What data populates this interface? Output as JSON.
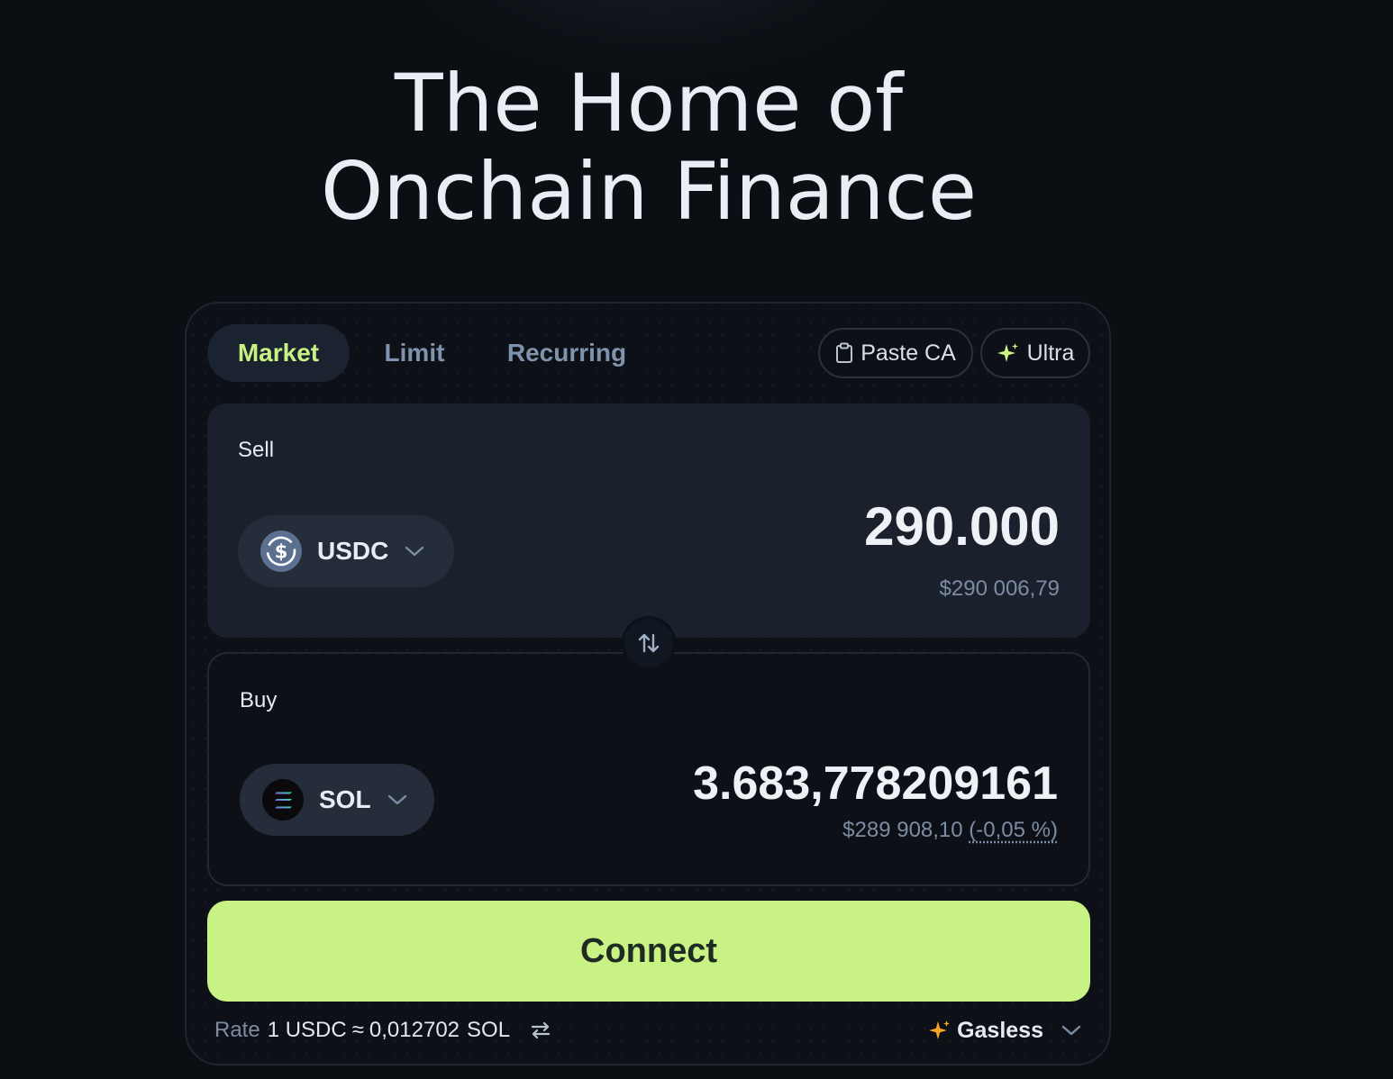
{
  "hero": {
    "line1": "The Home of",
    "line2": "Onchain Finance"
  },
  "tabs": [
    {
      "label": "Market",
      "active": true
    },
    {
      "label": "Limit",
      "active": false
    },
    {
      "label": "Recurring",
      "active": false
    }
  ],
  "actions": {
    "paste_ca": "Paste CA",
    "ultra": "Ultra"
  },
  "sell": {
    "label": "Sell",
    "token": "USDC",
    "token_icon": "usdc-icon",
    "amount": "290.000",
    "usd_value": "$290 006,79"
  },
  "buy": {
    "label": "Buy",
    "token": "SOL",
    "token_icon": "sol-icon",
    "amount": "3.683,778209161",
    "usd_value": "$289 908,10",
    "price_impact": "(-0,05 %)"
  },
  "connect_label": "Connect",
  "rate": {
    "label": "Rate",
    "from": "1 USDC",
    "approx": "≈",
    "value": "0,012702",
    "to_symbol": "SOL"
  },
  "gasless": {
    "label": "Gasless"
  },
  "colors": {
    "background": "#0b0e13",
    "accent": "#c8f284",
    "sell_panel": "#1b212c",
    "muted_text": "#7b8ca3",
    "gasless_spark": "#f5a623"
  }
}
